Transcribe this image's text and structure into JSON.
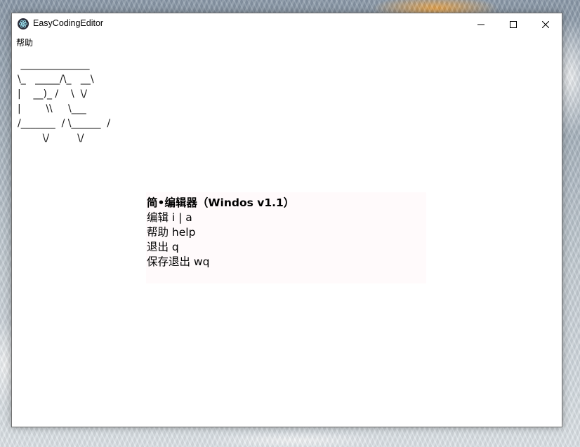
{
  "window": {
    "title": "EasyCodingEditor",
    "app_icon": "electron-atom-icon",
    "controls": {
      "minimize_icon": "minimize-icon",
      "maximize_icon": "maximize-icon",
      "close_icon": "close-icon"
    }
  },
  "menubar": {
    "items": [
      {
        "label": "帮助"
      }
    ]
  },
  "ascii_art": " ______________\n\\_   _____/\\_   __\\\n|    __)_ /    \\  \\/\n|        \\\\     \\___\n/_______  / \\______  /\n        \\/         \\/",
  "help_panel": {
    "title": "简•编辑器（Windos v1.1）",
    "lines": [
      "编辑 i | a",
      "帮助 help",
      "退出 q",
      "保存退出 wq"
    ]
  },
  "colors": {
    "window_bg": "#ffffff",
    "panel_bg": "#fffafb",
    "text": "#000000"
  }
}
